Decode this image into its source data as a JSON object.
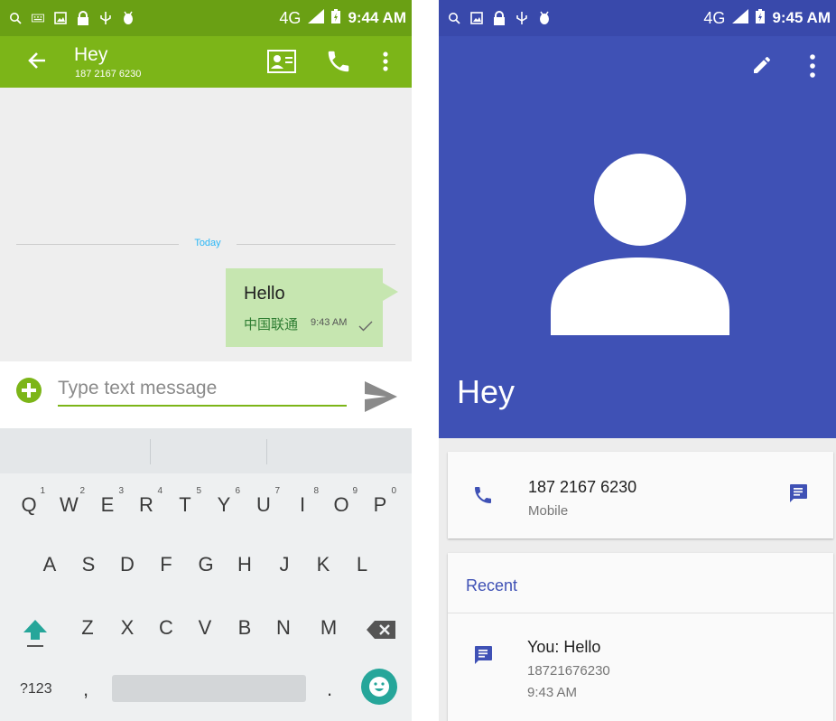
{
  "left": {
    "status": {
      "network": "4G",
      "time": "9:44 AM"
    },
    "appbar": {
      "title": "Hey",
      "subtitle": "187 2167 6230"
    },
    "conversation": {
      "date_divider": "Today",
      "messages": [
        {
          "text": "Hello",
          "carrier": "中国联通",
          "time": "9:43 AM",
          "status": "sent"
        }
      ]
    },
    "compose": {
      "placeholder": "Type text message"
    },
    "keyboard": {
      "row1": [
        {
          "label": "Q",
          "hint": "1"
        },
        {
          "label": "W",
          "hint": "2"
        },
        {
          "label": "E",
          "hint": "3"
        },
        {
          "label": "R",
          "hint": "4"
        },
        {
          "label": "T",
          "hint": "5"
        },
        {
          "label": "Y",
          "hint": "6"
        },
        {
          "label": "U",
          "hint": "7"
        },
        {
          "label": "I",
          "hint": "8"
        },
        {
          "label": "O",
          "hint": "9"
        },
        {
          "label": "P",
          "hint": "0"
        }
      ],
      "row2": [
        "A",
        "S",
        "D",
        "F",
        "G",
        "H",
        "J",
        "K",
        "L"
      ],
      "row3": [
        "Z",
        "X",
        "C",
        "V",
        "B",
        "N",
        "M"
      ],
      "symbols_key": "?123",
      "comma_key": ",",
      "period_key": "."
    }
  },
  "right": {
    "status": {
      "network": "4G",
      "time": "9:45 AM"
    },
    "contact": {
      "name": "Hey"
    },
    "phone": {
      "number": "187 2167 6230",
      "type": "Mobile"
    },
    "recent": {
      "title": "Recent",
      "items": [
        {
          "text": "You: Hello",
          "number": "18721676230",
          "time": "9:43 AM"
        }
      ]
    }
  },
  "colors": {
    "messaging_accent": "#7cb518",
    "contacts_primary": "#3f51b5",
    "outgoing_bubble": "#c6e6b0",
    "date_divider_text": "#29b6f6",
    "keyboard_emoji_button": "#26a69a"
  },
  "icons": {
    "status": [
      "search-icon",
      "keyboard-icon",
      "image-icon",
      "lock-icon",
      "usb-icon",
      "android-icon",
      "signal-icon",
      "battery-charging-icon"
    ],
    "left_appbar": [
      "back-arrow-icon",
      "contact-card-icon",
      "phone-icon",
      "more-vert-icon"
    ],
    "compose": [
      "add-icon",
      "send-icon"
    ],
    "right_appbar": [
      "edit-icon",
      "more-vert-icon"
    ],
    "right_cards": [
      "phone-icon",
      "message-icon"
    ]
  }
}
